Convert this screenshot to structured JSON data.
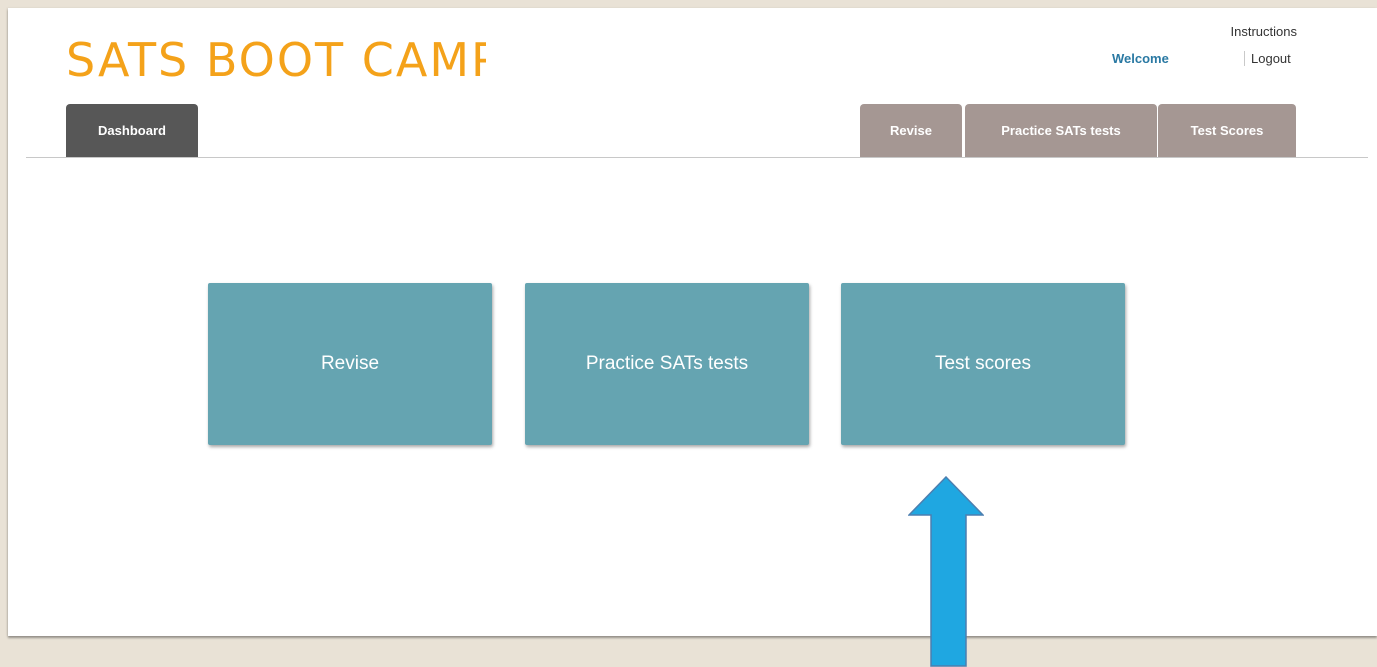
{
  "header": {
    "logo_text": "SATS BOOT CAMP",
    "instructions_label": "Instructions",
    "welcome_label": "Welcome",
    "logout_label": "Logout"
  },
  "nav": {
    "tabs": [
      {
        "label": "Dashboard",
        "active": true
      },
      {
        "label": "Revise",
        "active": false
      },
      {
        "label": "Practice SATs tests",
        "active": false
      },
      {
        "label": "Test Scores",
        "active": false
      }
    ]
  },
  "main": {
    "tiles": [
      {
        "label": "Revise"
      },
      {
        "label": "Practice SATs tests"
      },
      {
        "label": "Test scores"
      }
    ]
  },
  "annotation": {
    "icon": "up-arrow-icon",
    "points_to": "Test scores"
  },
  "colors": {
    "logo": "#f4a21a",
    "active_tab": "#575757",
    "inactive_tab": "#a59793",
    "tile": "#65a4b1",
    "welcome_link": "#2a79a3",
    "arrow_fill": "#1fa7e1",
    "arrow_stroke": "#4c7fb0",
    "backdrop": "#e9e2d6"
  }
}
